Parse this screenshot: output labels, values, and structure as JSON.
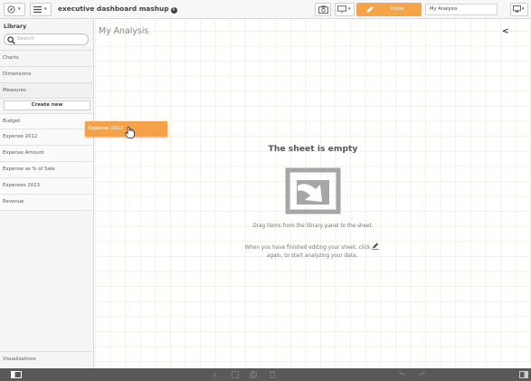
{
  "toolbar": {
    "app_title": "executive dashboard mashup",
    "info_glyph": "i",
    "done_label": "Done",
    "sheet_name": "My Analysis",
    "icons": [
      "compass-icon",
      "list-icon",
      "camera-icon",
      "present-icon",
      "bookmark-icon",
      "pencil-icon",
      "screen-icon"
    ]
  },
  "sidebar": {
    "title": "Library",
    "search_placeholder": "Search",
    "nav": [
      "Charts",
      "Dimensions",
      "Measures"
    ],
    "create_new": "Create new",
    "measures": [
      "Budget",
      "Expense 2012",
      "Expense Amount",
      "Expense as % of Sale",
      "Expenses 2013",
      "Revenue"
    ],
    "visualizations": "Visualizations"
  },
  "canvas": {
    "title": "My Analysis",
    "collapse_glyph": "<",
    "empty_title": "The sheet is empty",
    "empty_line1": "Drag items from the library panel to the sheet.",
    "empty_line2a": "When you have finished editing your sheet, click",
    "empty_line2b": "again, to start analyzing your data."
  },
  "drag": {
    "label": "Expense 2012"
  },
  "colors": {
    "accent": "#f4a24a",
    "bottom_bar": "#595959",
    "grid": "#f4f0e1"
  }
}
